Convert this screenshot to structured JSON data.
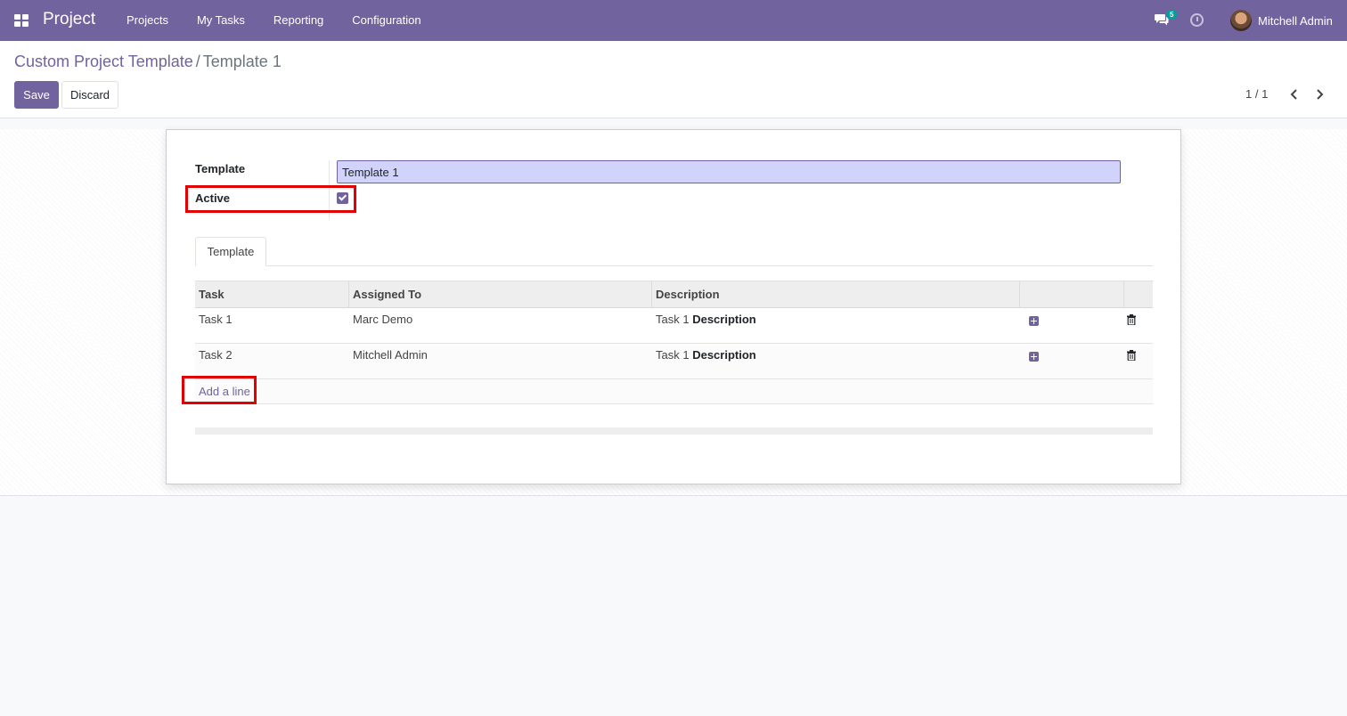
{
  "navbar": {
    "brand": "Project",
    "menu": [
      "Projects",
      "My Tasks",
      "Reporting",
      "Configuration"
    ],
    "message_count": "5",
    "user_name": "Mitchell Admin"
  },
  "breadcrumb": {
    "parent": "Custom Project Template",
    "separator": "/",
    "current": "Template 1"
  },
  "actions": {
    "save": "Save",
    "discard": "Discard"
  },
  "pager": {
    "value": "1 / 1"
  },
  "form": {
    "template_label": "Template",
    "template_value": "Template 1",
    "active_label": "Active",
    "active_checked": true,
    "tab": "Template"
  },
  "table": {
    "headers": [
      "Task",
      "Assigned To",
      "Description"
    ],
    "rows": [
      {
        "task": "Task 1",
        "assigned": "Marc Demo",
        "desc_plain": "Task 1",
        "desc_bold": "Description"
      },
      {
        "task": "Task 2",
        "assigned": "Mitchell Admin",
        "desc_plain": "Task 1",
        "desc_bold": "Description"
      }
    ],
    "add_line": "Add a line"
  },
  "colors": {
    "brand": "#71639e",
    "highlight": "#e20000",
    "input_bg": "#d1d3fa"
  }
}
